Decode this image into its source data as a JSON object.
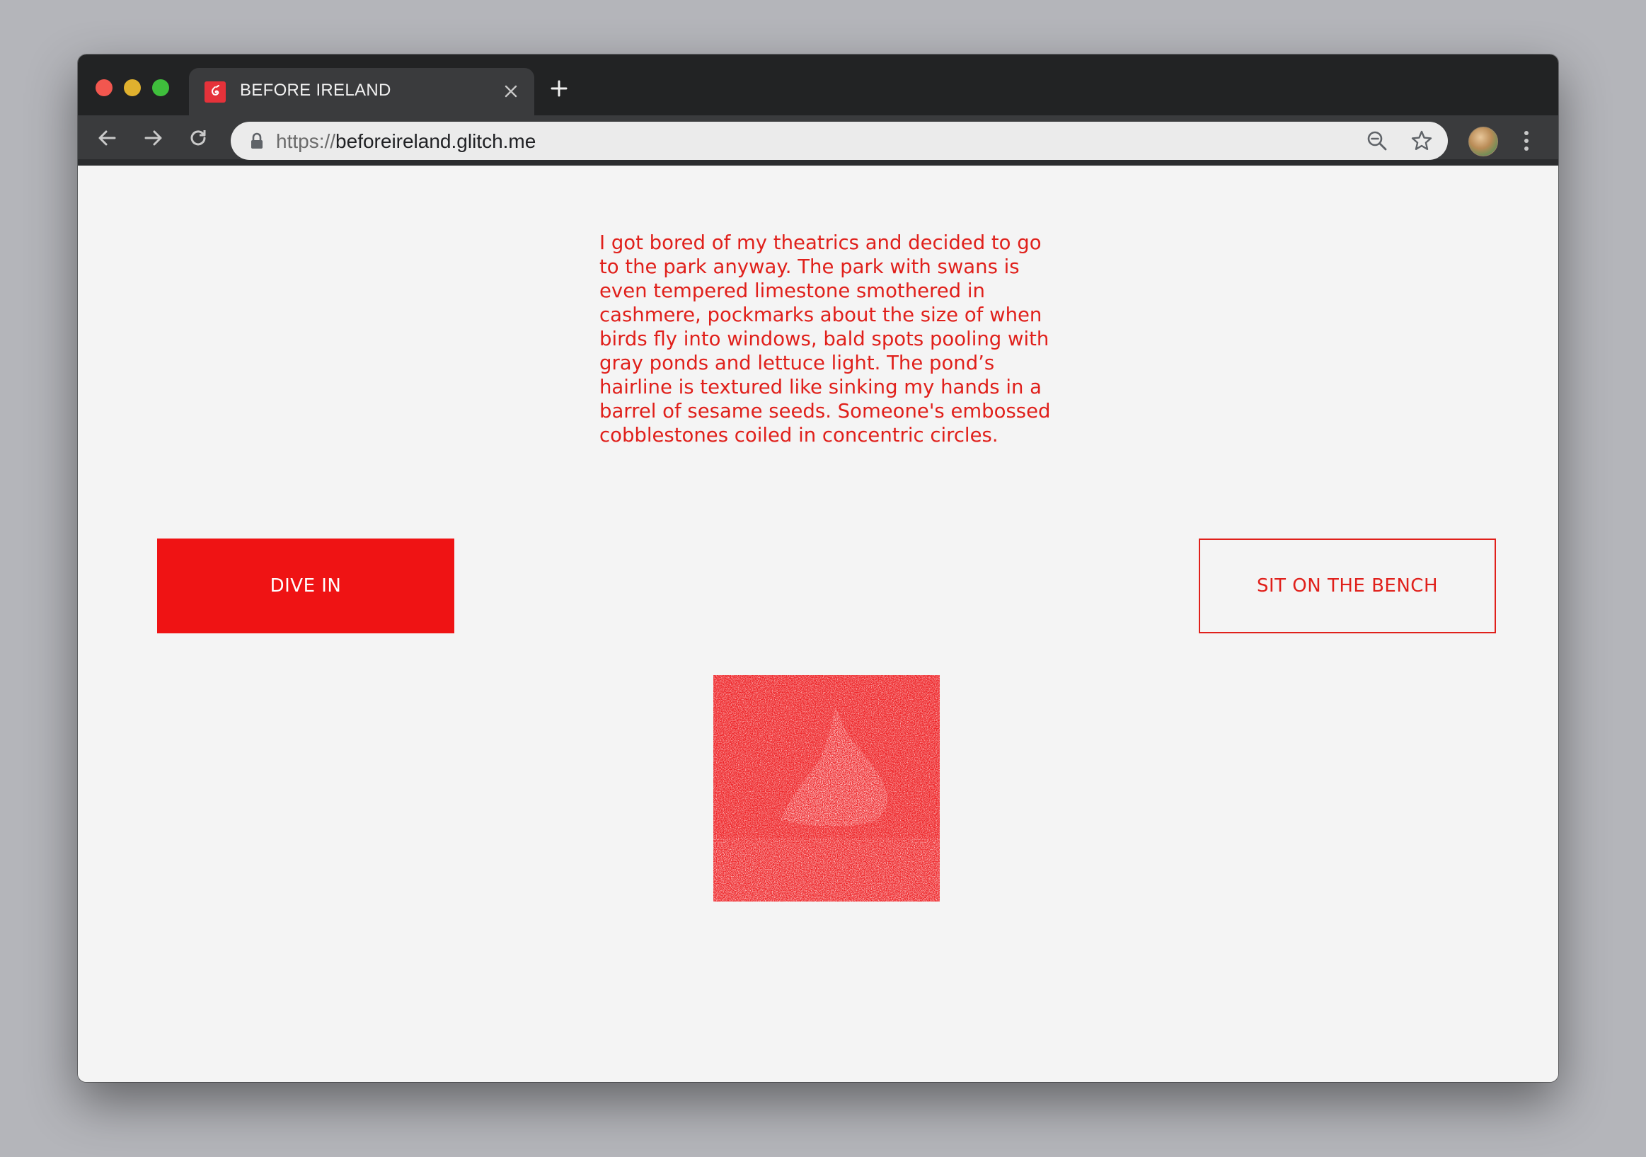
{
  "browser": {
    "tab_title": "BEFORE IRELAND",
    "tab_close_icon": "close-icon",
    "new_tab_icon": "plus-icon",
    "url_scheme": "https://",
    "url_host": "beforeireland.glitch.me",
    "colors": {
      "titlebar": "#222324",
      "toolbar": "#3a3b3d",
      "omnibox": "#ebebeb"
    }
  },
  "page": {
    "story": "I got bored of my theatrics and decided to go to the park anyway. The park with swans is even tempered limestone smothered in cashmere, pockmarks about the size of when birds fly into windows, bald spots pooling with gray ponds and lettuce light. The pond’s hairline is textured like sinking my hands in a barrel of sesame seeds. Someone's embossed cobblestones coiled in concentric circles.",
    "buttons": {
      "dive_in": "DIVE IN",
      "sit_on_bench": "SIT ON THE BENCH"
    },
    "colors": {
      "accent": "#ef1314",
      "text": "#e0201b",
      "background": "#f4f4f4"
    }
  }
}
